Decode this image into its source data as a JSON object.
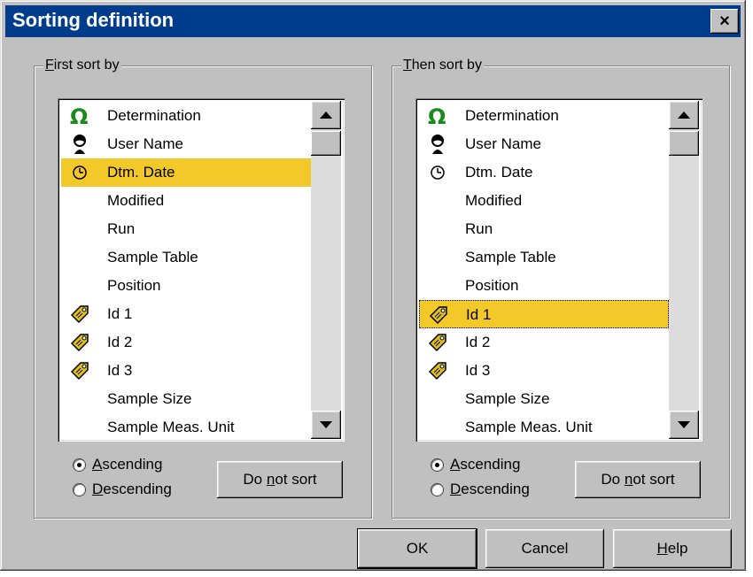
{
  "window": {
    "title": "Sorting definition",
    "close_label": "×"
  },
  "first_group": {
    "label": "First sort by",
    "items": [
      {
        "label": "Determination",
        "icon": "omega-icon"
      },
      {
        "label": "User Name",
        "icon": "user-icon"
      },
      {
        "label": "Dtm. Date",
        "icon": "clock-icon"
      },
      {
        "label": "Modified",
        "icon": ""
      },
      {
        "label": "Run",
        "icon": ""
      },
      {
        "label": "Sample Table",
        "icon": ""
      },
      {
        "label": "Position",
        "icon": ""
      },
      {
        "label": "Id 1",
        "icon": "tag-icon"
      },
      {
        "label": "Id 2",
        "icon": "tag-icon"
      },
      {
        "label": "Id 3",
        "icon": "tag-icon"
      },
      {
        "label": "Sample Size",
        "icon": ""
      },
      {
        "label": "Sample Meas. Unit",
        "icon": ""
      }
    ],
    "selected": "Dtm. Date",
    "ascending": "Ascending",
    "descending": "Descending",
    "order": "Ascending",
    "do_not_sort": "Do not sort"
  },
  "then_group": {
    "label": "Then sort by",
    "items": [
      {
        "label": "Determination",
        "icon": "omega-icon"
      },
      {
        "label": "User Name",
        "icon": "user-icon"
      },
      {
        "label": "Dtm. Date",
        "icon": "clock-icon"
      },
      {
        "label": "Modified",
        "icon": ""
      },
      {
        "label": "Run",
        "icon": ""
      },
      {
        "label": "Sample Table",
        "icon": ""
      },
      {
        "label": "Position",
        "icon": ""
      },
      {
        "label": "Id 1",
        "icon": "tag-icon"
      },
      {
        "label": "Id 2",
        "icon": "tag-icon"
      },
      {
        "label": "Id 3",
        "icon": "tag-icon"
      },
      {
        "label": "Sample Size",
        "icon": ""
      },
      {
        "label": "Sample Meas. Unit",
        "icon": ""
      }
    ],
    "selected": "Id 1",
    "ascending": "Ascending",
    "descending": "Descending",
    "order": "Ascending",
    "do_not_sort": "Do not sort"
  },
  "buttons": {
    "ok": "OK",
    "cancel": "Cancel",
    "help": "Help"
  },
  "colors": {
    "titlebar": "#003c8c",
    "selection": "#f2c928",
    "omega": "#1a8a1a",
    "tag": "#e0c020"
  }
}
